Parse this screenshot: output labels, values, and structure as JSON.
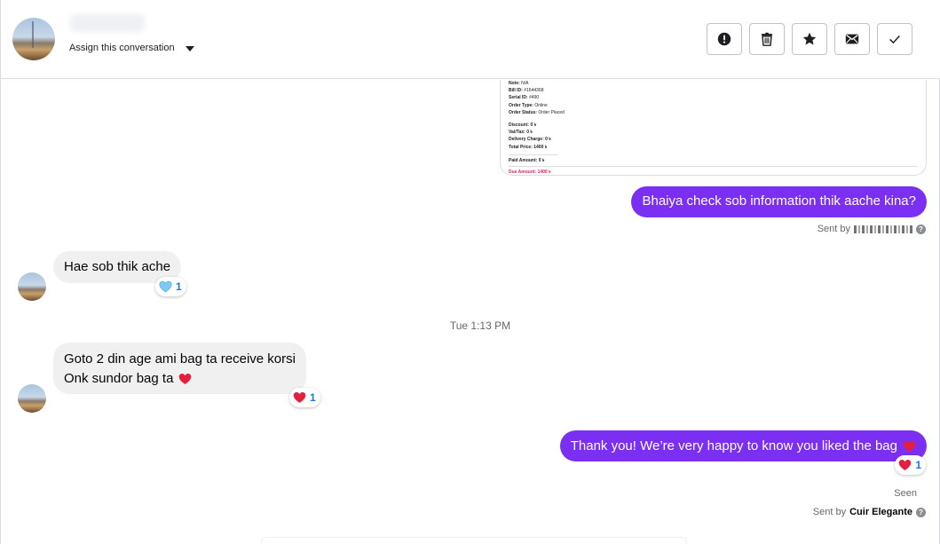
{
  "header": {
    "assign_label": "Assign this conversation",
    "toolbar": [
      {
        "name": "mark-spam-button",
        "icon": "exclamation-icon"
      },
      {
        "name": "delete-button",
        "icon": "trash-icon"
      },
      {
        "name": "star-button",
        "icon": "star-icon"
      },
      {
        "name": "mark-unread-button",
        "icon": "envelope-icon"
      },
      {
        "name": "mark-done-button",
        "icon": "checkmark-icon"
      }
    ]
  },
  "receipt": {
    "lines": [
      {
        "label": "Note:",
        "value": "N/A"
      },
      {
        "label": "Bill ID:",
        "value": "#1644368"
      },
      {
        "label": "Serial ID:",
        "value": "#490"
      },
      {
        "label": "Order Type:",
        "value": "Online"
      },
      {
        "label": "Order Status:",
        "value": "Order Placed"
      }
    ],
    "totals": [
      {
        "label": "Discount:",
        "value": "0 ৳"
      },
      {
        "label": "Vat/Tax:",
        "value": "0 ৳"
      },
      {
        "label": "Delivery Charge:",
        "value": "0 ৳"
      },
      {
        "label": "Total Price:",
        "value": "1400 ৳"
      }
    ],
    "payment": [
      {
        "label": "Paid Amount:",
        "value": "0 ৳"
      },
      {
        "label": "Due Amount:",
        "value": "1400 ৳"
      }
    ]
  },
  "messages": {
    "m1": {
      "text": "Bhaiya check sob information thik aache kina?",
      "sent_by_label": "Sent by"
    },
    "m2": {
      "text": "Hae sob thik ache",
      "reaction_count": "1"
    },
    "timestamp": "Tue 1:13 PM",
    "m3": {
      "line1": "Goto 2 din age ami bag ta receive korsi",
      "line2": "Onk sundor bag ta",
      "reaction_count": "1"
    },
    "m4": {
      "text": "Thank you! We’re very happy to know you liked the bag",
      "reaction_count": "1"
    },
    "seen": "Seen",
    "sent_by_label": "Sent by",
    "sender": "Cuir Elegante"
  },
  "colors": {
    "outgoing_bubble": "#7b2ff2",
    "incoming_bubble": "#f0f0f0",
    "reaction_count": "#1877f2",
    "heart_red": "#e41e3f",
    "heart_blue": "#7ec8f2"
  }
}
